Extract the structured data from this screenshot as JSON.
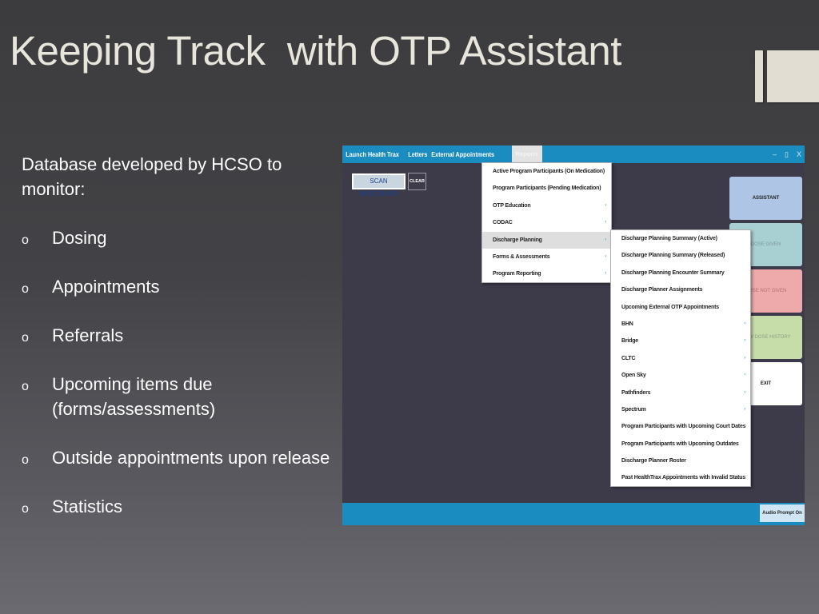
{
  "slide": {
    "title": "Keeping Track  with OTP Assistant",
    "intro": "Database developed by HCSO to monitor:",
    "bullet_marker": "o",
    "bullets": [
      "Dosing",
      "Appointments",
      "Referrals",
      "Upcoming items due (forms/assessments)",
      "Outside appointments upon release",
      "Statistics"
    ]
  },
  "app": {
    "menubar": {
      "items": [
        "Launch Health Trax",
        "Letters",
        "External Appointments",
        "Reports"
      ],
      "active_index": 3
    },
    "window_controls": {
      "minimize": "–",
      "maximize": "▯",
      "close": "X"
    },
    "scan_button": "SCAN WRISTBAND",
    "clear_button": "CLEAR",
    "partial_hidden_char": "s",
    "side_buttons": {
      "assistant": "ASSISTANT",
      "dose_given": "DOSE GIVEN",
      "dose_not_given": "DOSE NOT GIVEN",
      "dose_history": "VIEW DOSE HISTORY",
      "exit": "EXIT"
    },
    "audio_prompt_button": "Audio Prompt On",
    "reports_menu": {
      "items": [
        {
          "label": "Active Program Participants (On Medication)",
          "submenu": false
        },
        {
          "label": "Program Participants (Pending Medication)",
          "submenu": false
        },
        {
          "label": "OTP Education",
          "submenu": true
        },
        {
          "label": "CODAC",
          "submenu": true
        },
        {
          "label": "Discharge Planning",
          "submenu": true,
          "highlighted": true
        },
        {
          "label": "Forms & Assessments",
          "submenu": true
        },
        {
          "label": "Program Reporting",
          "submenu": true
        }
      ]
    },
    "discharge_menu": {
      "items": [
        {
          "label": "Discharge Planning Summary (Active)",
          "submenu": false
        },
        {
          "label": "Discharge Planning Summary (Released)",
          "submenu": false
        },
        {
          "label": "Discharge Planning Encounter Summary",
          "submenu": false
        },
        {
          "label": "Discharge Planner Assignments",
          "submenu": false
        },
        {
          "label": "Upcoming External OTP Appointments",
          "submenu": false
        },
        {
          "label": "BHN",
          "submenu": true
        },
        {
          "label": "Bridge",
          "submenu": true
        },
        {
          "label": "CLTC",
          "submenu": true
        },
        {
          "label": "Open Sky",
          "submenu": true
        },
        {
          "label": "Pathfinders",
          "submenu": true
        },
        {
          "label": "Spectrum",
          "submenu": true
        },
        {
          "label": "Program Participants with Upcoming Court Dates",
          "submenu": false
        },
        {
          "label": "Program Participants with Upcoming Outdates",
          "submenu": false
        },
        {
          "label": "Discharge Planner Roster",
          "submenu": false
        },
        {
          "label": "Past HealthTrax Appointments with Invalid Status",
          "submenu": false
        }
      ]
    },
    "submenu_arrow": "›",
    "colors": {
      "accent_blue": "#1b8cc0",
      "assistant": "#aec5e6",
      "dose_given": "#a8cfd2",
      "dose_not_given": "#eeaaaa",
      "dose_history": "#c6ddaa",
      "exit": "#ffffff",
      "app_background": "#3d3b4a"
    }
  }
}
